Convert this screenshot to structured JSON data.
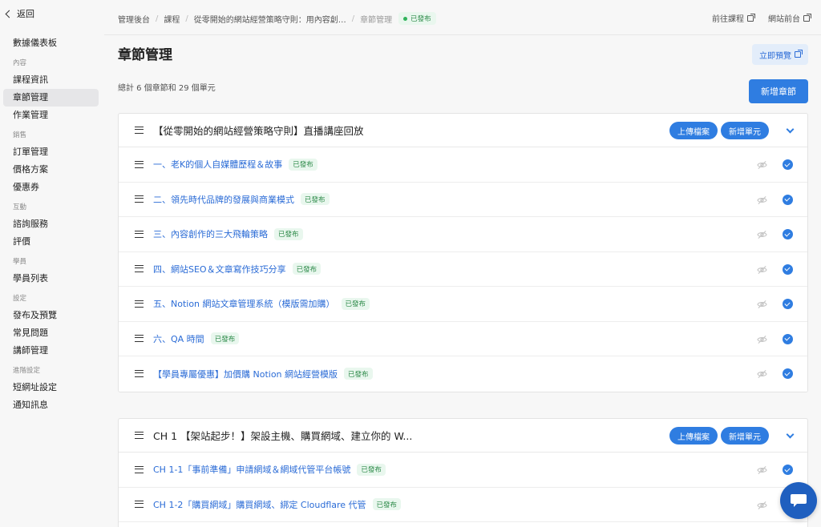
{
  "sidebar": {
    "back_label": "返回",
    "dashboard": "數據儀表板",
    "groups": [
      {
        "label": "內容",
        "items": [
          "課程資訊",
          "章節管理",
          "作業管理"
        ]
      },
      {
        "label": "銷售",
        "items": [
          "訂單管理",
          "價格方案",
          "優惠券"
        ]
      },
      {
        "label": "互動",
        "items": [
          "諮詢服務",
          "評價"
        ]
      },
      {
        "label": "學員",
        "items": [
          "學員列表"
        ]
      },
      {
        "label": "設定",
        "items": [
          "發布及預覽",
          "常見問題",
          "講師管理"
        ]
      },
      {
        "label": "進階設定",
        "items": [
          "短網址設定",
          "通知訊息"
        ]
      }
    ],
    "active_item": "章節管理"
  },
  "breadcrumb": {
    "items": [
      "管理後台",
      "課程",
      "從零開始的網站經營策略守則：用內容創…",
      "章節管理"
    ],
    "status": "已發布"
  },
  "top_links": {
    "go_course": "前往課程",
    "site_front": "網站前台"
  },
  "page": {
    "title": "章節管理",
    "preview_label": "立即預覽",
    "summary": "總計 6 個章節和 29 個單元",
    "add_chapter_label": "新增章節"
  },
  "chapters": [
    {
      "title": "【從零開始的網站經營策略守則】直播講座回放",
      "upload_label": "上傳檔案",
      "add_unit_label": "新增單元",
      "units": [
        {
          "title": "一、老K的個人自媒體歷程＆故事",
          "status": "已發布"
        },
        {
          "title": "二、領先時代品牌的發展與商業模式",
          "status": "已發布"
        },
        {
          "title": "三、內容創作的三大飛輪策略",
          "status": "已發布"
        },
        {
          "title": "四、網站SEO＆文章寫作技巧分享",
          "status": "已發布"
        },
        {
          "title": "五、Notion 網站文章管理系統（模版需加購）",
          "status": "已發布"
        },
        {
          "title": "六、QA 時間",
          "status": "已發布"
        },
        {
          "title": "【學員專屬優惠】加價購 Notion 網站經營模版",
          "status": "已發布"
        }
      ]
    },
    {
      "title": "CH 1 【架站起步！】架設主機、購買網域、建立你的 W...",
      "upload_label": "上傳檔案",
      "add_unit_label": "新增單元",
      "units": [
        {
          "title": "CH 1-1「事前準備」申請網域＆網域代管平台帳號",
          "status": "已發布"
        },
        {
          "title": "CH 1-2「購買網域」購買網域、綁定 Cloudflare 代管",
          "status": "已發布"
        }
      ]
    }
  ],
  "colors": {
    "accent": "#2f7de1",
    "published_bg": "#e9f7ee",
    "published_text": "#2e8b4a",
    "chat": "#1f5fbf"
  }
}
